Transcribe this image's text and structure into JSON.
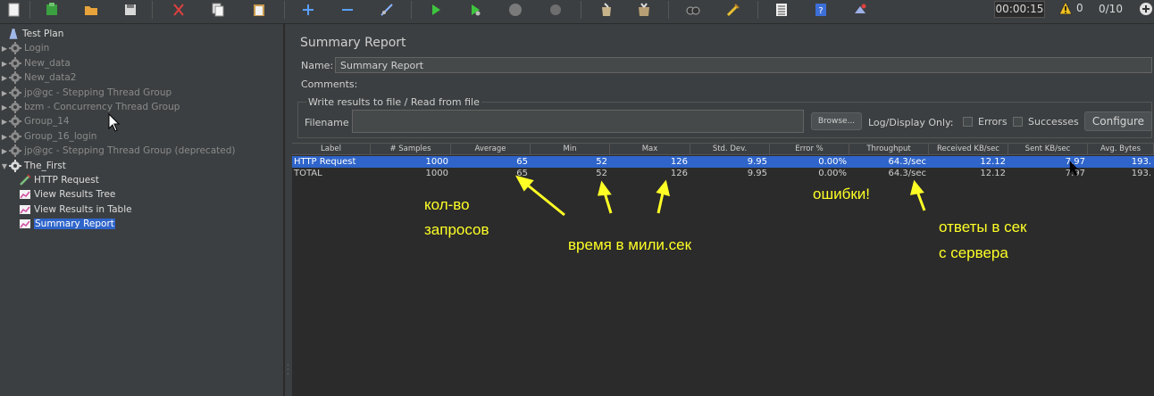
{
  "toolbar": {
    "buttons": [
      "new-icon",
      "templates-icon",
      "open-icon",
      "save-icon",
      "cut-icon",
      "copy-icon",
      "paste-icon",
      "expand-icon",
      "collapse-icon",
      "toggle-icon",
      "start-icon",
      "start-no-pauses-icon",
      "stop-icon",
      "shutdown-icon",
      "clear-icon",
      "clear-all-icon",
      "search-icon",
      "reset-search-icon",
      "function-helper-icon",
      "help-icon",
      "remote-icon"
    ],
    "elapsed_time": "00:00:15",
    "warnings_count": "0",
    "threads": "0/10"
  },
  "tree": {
    "items": [
      {
        "label": "Test Plan",
        "state": "enabled",
        "icon": "test-plan-icon",
        "toggle": "",
        "indent": 0
      },
      {
        "label": "Login",
        "state": "disabled",
        "icon": "thread-group-icon",
        "toggle": "▶",
        "indent": 0
      },
      {
        "label": "New_data",
        "state": "disabled",
        "icon": "thread-group-icon",
        "toggle": "▶",
        "indent": 0
      },
      {
        "label": "New_data2",
        "state": "disabled",
        "icon": "thread-group-icon",
        "toggle": "▶",
        "indent": 0
      },
      {
        "label": "jp@gc - Stepping Thread Group",
        "state": "disabled",
        "icon": "thread-group-icon",
        "toggle": "▶",
        "indent": 0
      },
      {
        "label": "bzm - Concurrency Thread Group",
        "state": "disabled",
        "icon": "thread-group-icon",
        "toggle": "▶",
        "indent": 0
      },
      {
        "label": "Group_14",
        "state": "disabled",
        "icon": "thread-group-icon",
        "toggle": "▶",
        "indent": 0
      },
      {
        "label": "Group_16_login",
        "state": "disabled",
        "icon": "thread-group-icon",
        "toggle": "▶",
        "indent": 0
      },
      {
        "label": "jp@gc - Stepping Thread Group (deprecated)",
        "state": "disabled",
        "icon": "thread-group-icon",
        "toggle": "▶",
        "indent": 0
      },
      {
        "label": "The_First",
        "state": "enabled",
        "icon": "thread-group-icon",
        "toggle": "▼",
        "indent": 0
      },
      {
        "label": "HTTP Request",
        "state": "enabled",
        "icon": "sampler-icon",
        "toggle": "",
        "indent": 1
      },
      {
        "label": "View Results Tree",
        "state": "enabled",
        "icon": "listener-icon",
        "toggle": "",
        "indent": 1
      },
      {
        "label": "View Results in Table",
        "state": "enabled",
        "icon": "listener-icon",
        "toggle": "",
        "indent": 1
      },
      {
        "label": "Summary Report",
        "state": "selected",
        "icon": "listener-icon",
        "toggle": "",
        "indent": 1
      }
    ]
  },
  "report": {
    "title": "Summary Report",
    "name_label": "Name:",
    "name_value": "Summary Report",
    "comments_label": "Comments:",
    "file_group_title": "Write results to file / Read from file",
    "filename_label": "Filename",
    "browse_label": "Browse...",
    "log_display_label": "Log/Display Only:",
    "errors_label": "Errors",
    "successes_label": "Successes",
    "configure_label": "Configure"
  },
  "table": {
    "columns": [
      "Label",
      "# Samples",
      "Average",
      "Min",
      "Max",
      "Std. Dev.",
      "Error %",
      "Throughput",
      "Received KB/sec",
      "Sent KB/sec",
      "Avg. Bytes"
    ],
    "rows": [
      {
        "selected": true,
        "cells": [
          "HTTP Request",
          "1000",
          "65",
          "52",
          "126",
          "9.95",
          "0.00%",
          "64.3/sec",
          "12.12",
          "7.97",
          "193."
        ]
      },
      {
        "selected": false,
        "cells": [
          "TOTAL",
          "1000",
          "65",
          "52",
          "126",
          "9.95",
          "0.00%",
          "64.3/sec",
          "12.12",
          "7.97",
          "193."
        ]
      }
    ]
  },
  "annotations": {
    "samples_line1": "кол-во",
    "samples_line2": "запросов",
    "time": "время в мили.сек",
    "errors": "ошибки!",
    "throughput_line1": "ответы в сек",
    "throughput_line2": "с сервера",
    "color": "#ffff26"
  },
  "colors": {
    "selection": "#2f65ca",
    "background": "#3c3f41",
    "table_background": "#2b2b2b"
  }
}
